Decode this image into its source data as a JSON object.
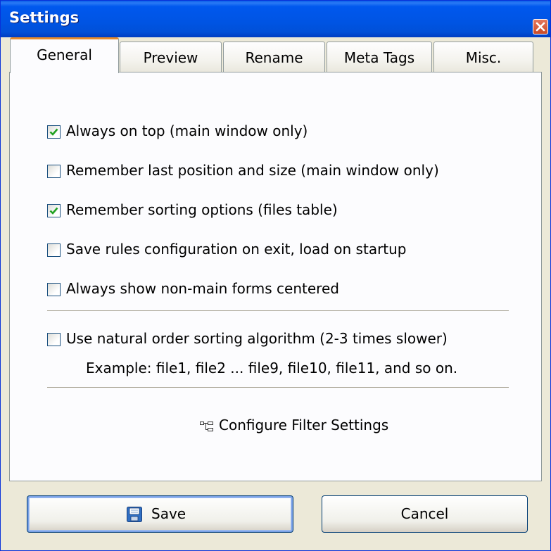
{
  "window": {
    "title": "Settings"
  },
  "tabs": [
    {
      "label": "General",
      "active": true
    },
    {
      "label": "Preview",
      "active": false
    },
    {
      "label": "Rename",
      "active": false
    },
    {
      "label": "Meta Tags",
      "active": false
    },
    {
      "label": "Misc.",
      "active": false
    }
  ],
  "options": [
    {
      "label": "Always on top (main window only)",
      "checked": true
    },
    {
      "label": "Remember last position and size (main window only)",
      "checked": false
    },
    {
      "label": "Remember sorting options (files table)",
      "checked": true
    },
    {
      "label": "Save rules configuration on exit, load on startup",
      "checked": false
    },
    {
      "label": "Always show non-main forms centered",
      "checked": false
    },
    {
      "label": "Use natural order sorting algorithm (2-3 times slower)",
      "checked": false
    }
  ],
  "natural_sort_example": "Example: file1, file2 ... file9, file10, file11, and so on.",
  "filter_link": {
    "label": "Configure Filter Settings",
    "icon": "filter-tree-icon"
  },
  "buttons": {
    "save": "Save",
    "cancel": "Cancel"
  },
  "colors": {
    "titlebar": "#0054e3",
    "active_tab_accent": "#e68b2c",
    "checkmark": "#21a121",
    "close_button": "#d45a35"
  }
}
